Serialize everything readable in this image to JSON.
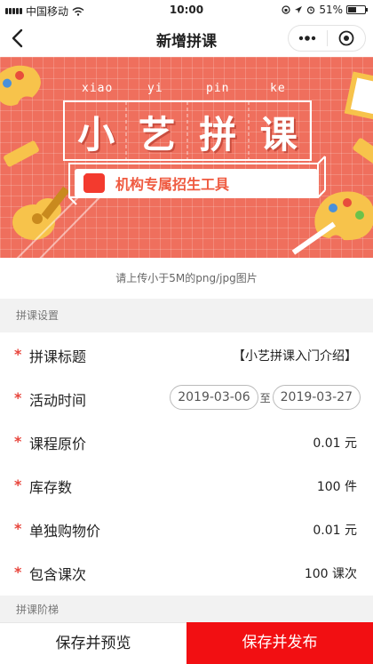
{
  "status_bar": {
    "carrier": "中国移动",
    "time": "10:00",
    "battery": "51%",
    "battery_level": 0.51
  },
  "nav": {
    "title": "新增拼课",
    "back_icon": "back-arrow-icon",
    "more_icon": "more-dots-icon",
    "close_icon": "target-circle-icon"
  },
  "banner": {
    "pinyin": [
      "xiao",
      "yi",
      "pin",
      "ke"
    ],
    "title_chars": [
      "小",
      "艺",
      "拼",
      "课"
    ],
    "logo_text": "小艺拼课",
    "slogan": "机构专属招生工具",
    "bg_color": "#ef6f5d"
  },
  "upload_hint": "请上传小于5M的png/jpg图片",
  "section_settings": "拼课设置",
  "form": {
    "title": {
      "label": "拼课标题",
      "value": "【小艺拼课入门介绍】"
    },
    "time": {
      "label": "活动时间",
      "start": "2019-03-06",
      "to": "至",
      "end": "2019-03-27"
    },
    "price": {
      "label": "课程原价",
      "value": "0.01 元"
    },
    "stock": {
      "label": "库存数",
      "value": "100 件"
    },
    "single_price": {
      "label": "单独购物价",
      "value": "0.01 元"
    },
    "lessons": {
      "label": "包含课次",
      "value": "100 课次"
    },
    "required_mark": "*"
  },
  "section_tiers": "拼课阶梯",
  "actions": {
    "preview": "保存并预览",
    "publish": "保存并发布",
    "accent": "#f20f12"
  }
}
